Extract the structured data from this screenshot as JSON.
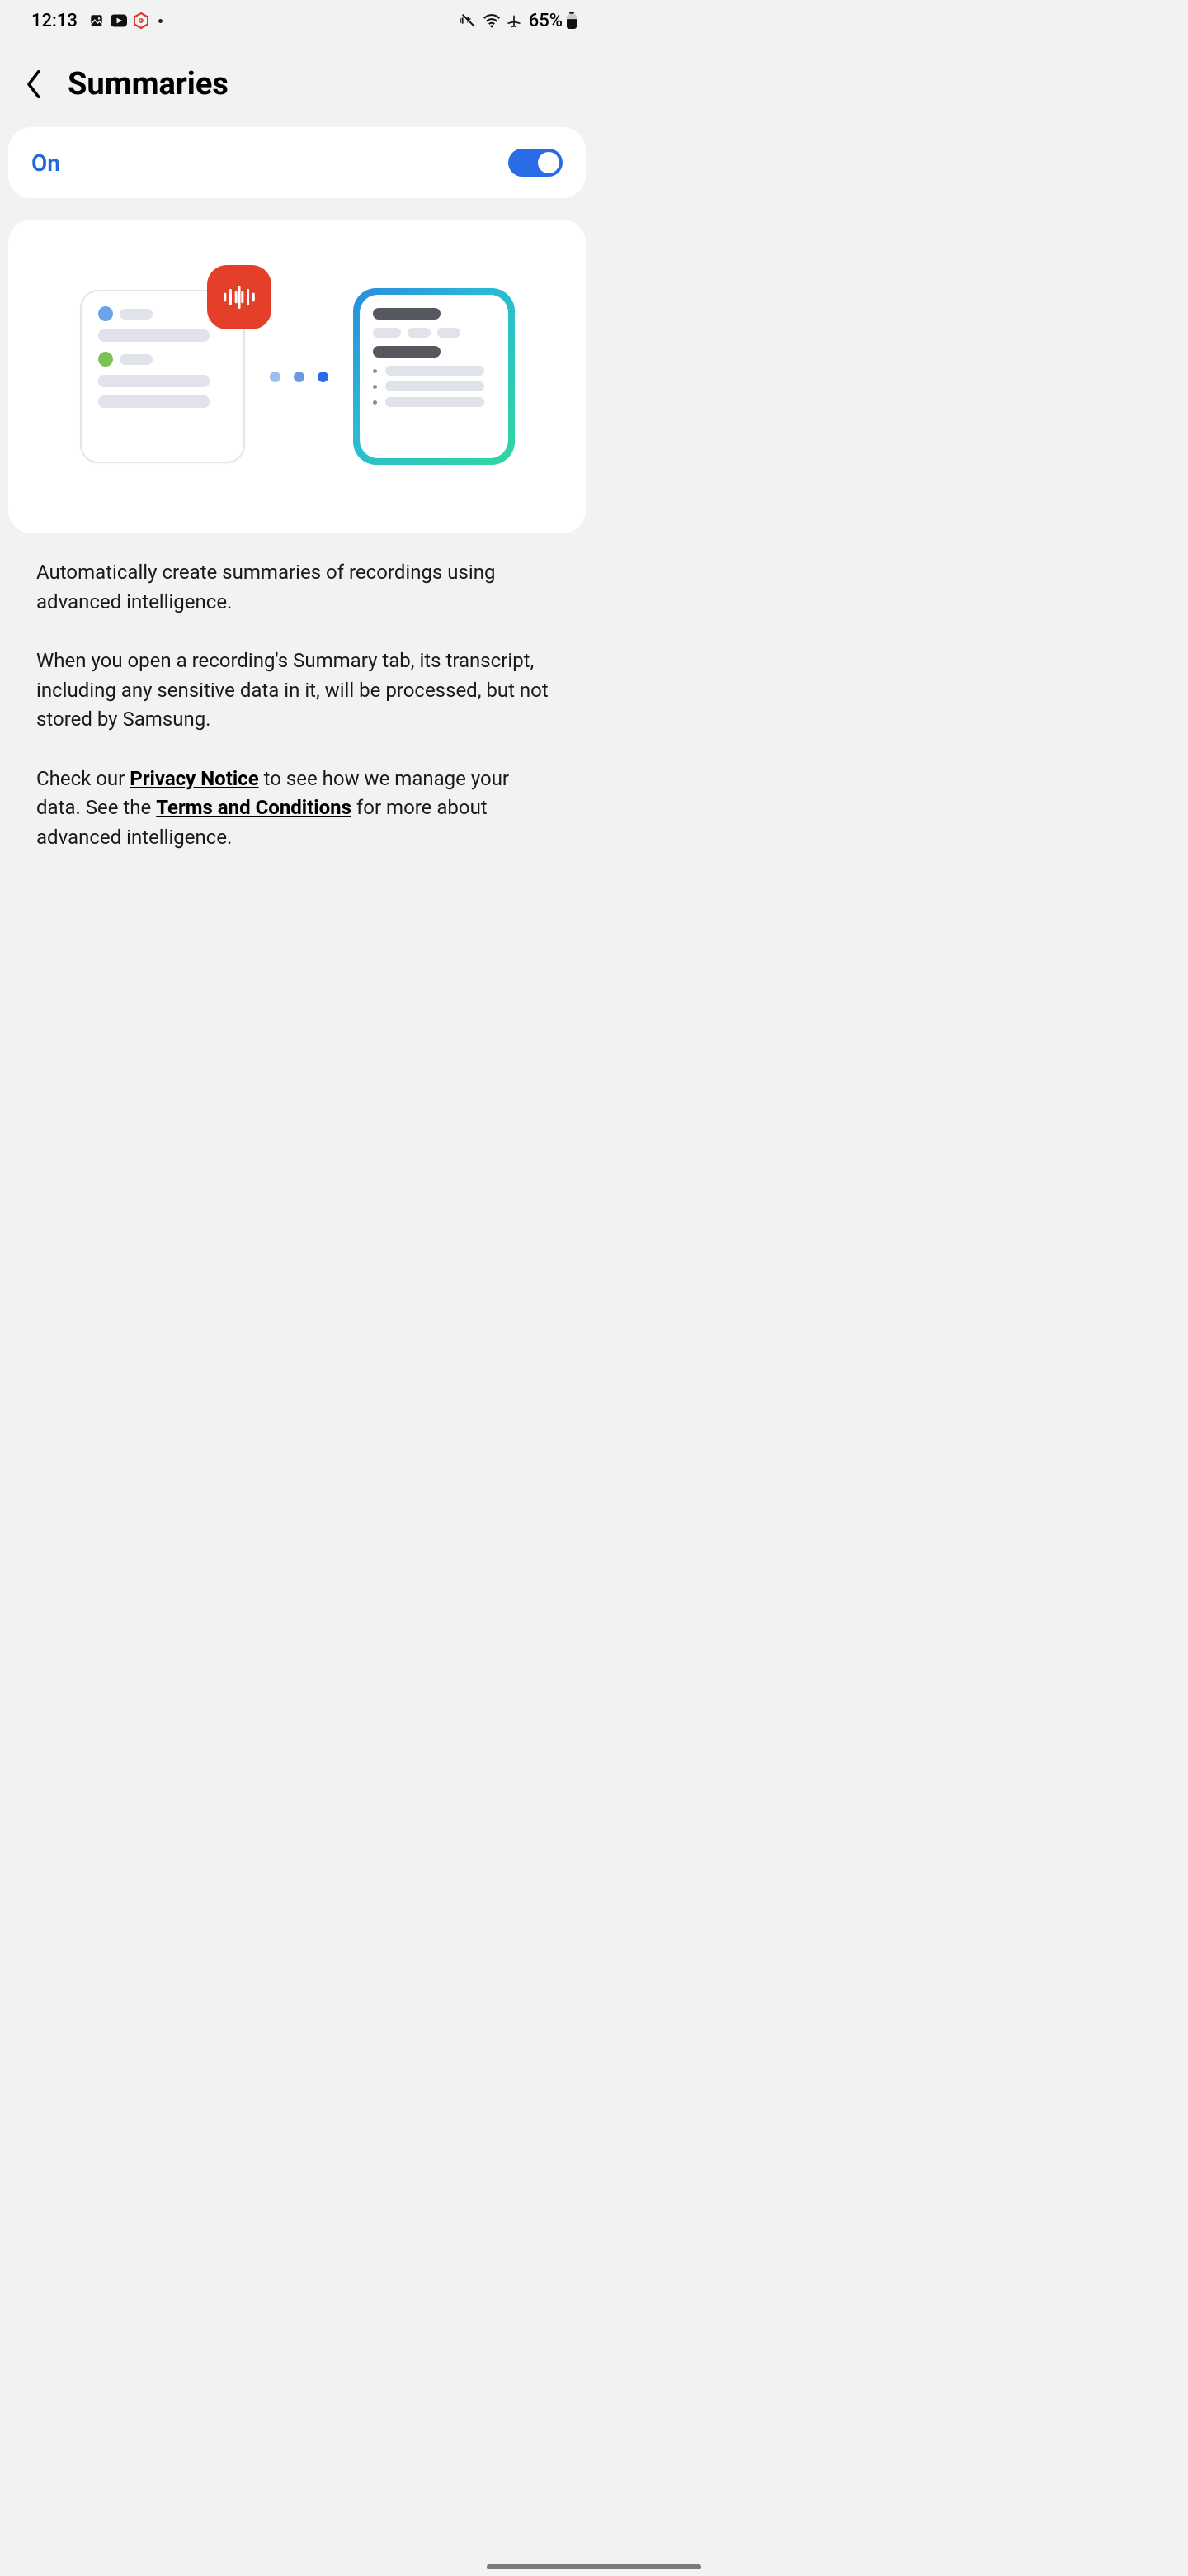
{
  "status_bar": {
    "time": "12:13",
    "battery_text": "65%"
  },
  "header": {
    "title": "Summaries"
  },
  "toggle": {
    "label": "On",
    "enabled": true
  },
  "body": {
    "p1": "Automatically create summaries of recordings using advanced intelligence.",
    "p2": "When you open a recording's Summary tab, its transcript, including any sensitive data in it, will be processed, but not stored by Samsung.",
    "p3_pre": "Check our ",
    "p3_link1": "Privacy Notice",
    "p3_mid": " to see how we manage your data. See the ",
    "p3_link2": "Terms and Conditions",
    "p3_post": " for more about advanced intelligence."
  }
}
